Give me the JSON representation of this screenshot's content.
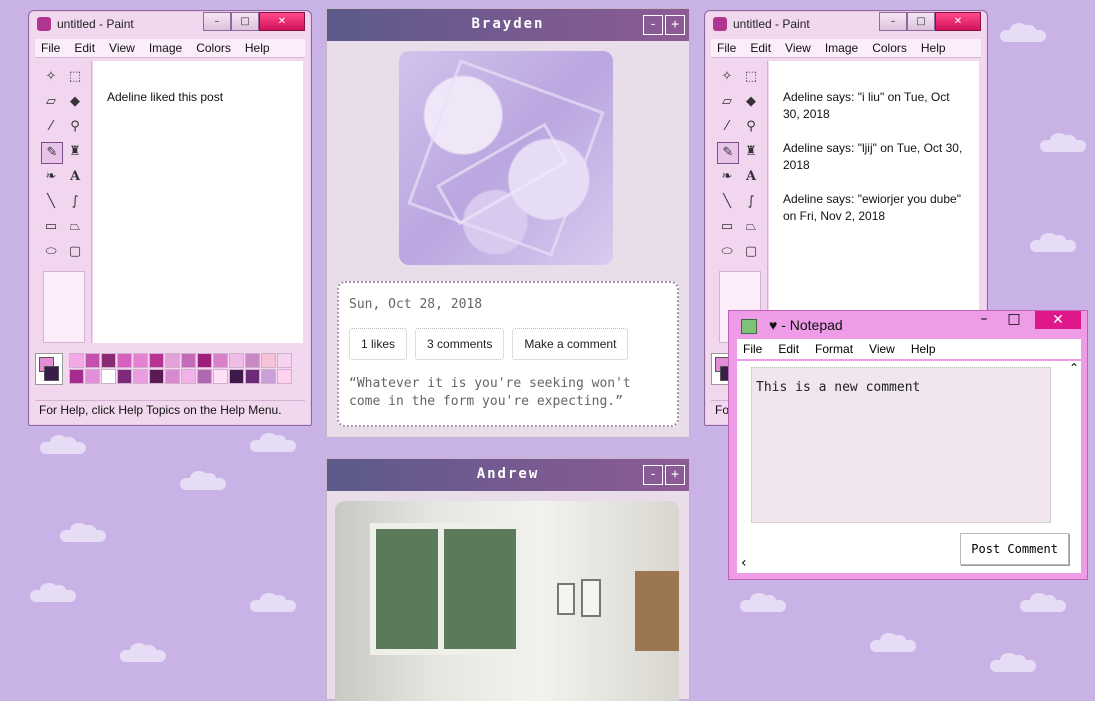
{
  "paint_left": {
    "title": "untitled - Paint",
    "menu": [
      "File",
      "Edit",
      "View",
      "Image",
      "Colors",
      "Help"
    ],
    "canvas_lines": [
      "Adeline liked this post"
    ],
    "status": "For Help, click Help Topics on the Help Menu."
  },
  "paint_right": {
    "title": "untitled - Paint",
    "menu": [
      "File",
      "Edit",
      "View",
      "Image",
      "Colors",
      "Help"
    ],
    "canvas_lines": [
      "Adeline says: \"i liu\" on Tue, Oct 30, 2018",
      "Adeline says: \"ljij\" on Tue, Oct 30, 2018",
      "Adeline says: \"ewiorjer you dube\" on Fri, Nov 2, 2018"
    ],
    "status": "For"
  },
  "window_buttons": {
    "minimize": "–",
    "maximize": "□",
    "close": "✕"
  },
  "palette_colors": [
    "#f2a9e6",
    "#c44fae",
    "#8a2a74",
    "#d65fbf",
    "#e77fd2",
    "#b83296",
    "#e3a2d9",
    "#c36bb8",
    "#9e1f7a",
    "#d780c9",
    "#f0bde8",
    "#c989c4",
    "#f5c2d7",
    "#f6d3f0",
    "#a62d8f",
    "#e090d8",
    "#ffffff",
    "#7d2a7a",
    "#ea9ce0",
    "#5a1a54",
    "#d88ad0",
    "#f1b3e7",
    "#b069b0",
    "#ffe0f6",
    "#3f1a48",
    "#6c2b7a",
    "#c9a0d8",
    "#ffd0f0"
  ],
  "posts": [
    {
      "author": "Brayden",
      "min_label": "-",
      "max_label": "+",
      "date": "Sun, Oct 28, 2018",
      "likes": "1 likes",
      "comments": "3 comments",
      "make_comment": "Make a comment",
      "quote": "“Whatever it is you're seeking won't come in the form you're expecting.”"
    },
    {
      "author": "Andrew",
      "min_label": "-",
      "max_label": "+"
    }
  ],
  "notepad": {
    "title": "♥ - Notepad",
    "menu": [
      "File",
      "Edit",
      "Format",
      "View",
      "Help"
    ],
    "text": "This is a new comment",
    "post_button": "Post Comment"
  }
}
